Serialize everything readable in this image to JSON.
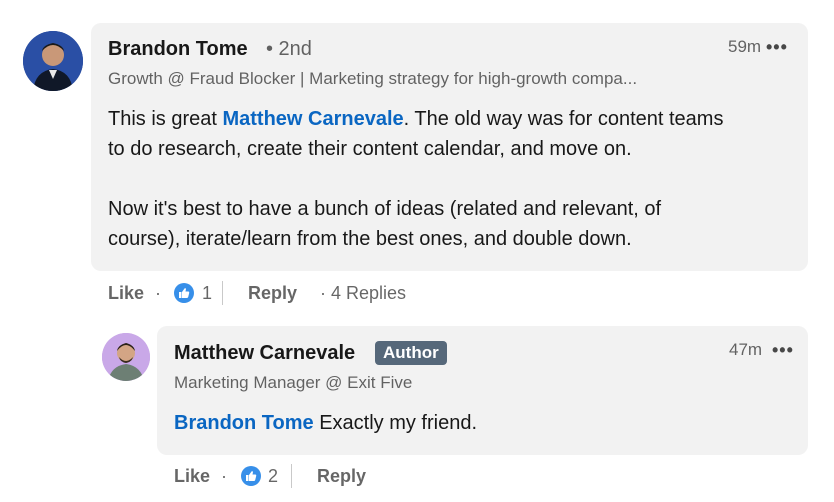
{
  "comment": {
    "author_name": "Brandon Tome",
    "degree": "• 2nd",
    "headline": "Growth @ Fraud Blocker | Marketing strategy for high-growth compa...",
    "time": "59m",
    "more_icon": "•••",
    "body": {
      "line1_prefix": "This is great ",
      "mention": "Matthew Carnevale",
      "line1_suffix": ". The old way was for content teams",
      "line2": "to do research, create their content calendar, and move on.",
      "line3": "Now it's best to have a bunch of ideas (related and relevant, of",
      "line4": "course), iterate/learn from the best ones, and double down."
    },
    "actions": {
      "like_label": "Like",
      "dot": "·",
      "like_count": "1",
      "reply_label": "Reply",
      "replies_label": "· 4 Replies"
    }
  },
  "reply": {
    "author_name": "Matthew Carnevale",
    "badge": "Author",
    "headline": "Marketing Manager @ Exit Five",
    "time": "47m",
    "more_icon": "•••",
    "body": {
      "mention": "Brandon Tome",
      "text": " Exactly my friend."
    },
    "actions": {
      "like_label": "Like",
      "dot": "·",
      "like_count": "2",
      "reply_label": "Reply"
    }
  },
  "colors": {
    "link": "#0a66c2",
    "bubble": "#f2f2f2",
    "badge": "#56687a",
    "like_blue": "#378fe9"
  }
}
